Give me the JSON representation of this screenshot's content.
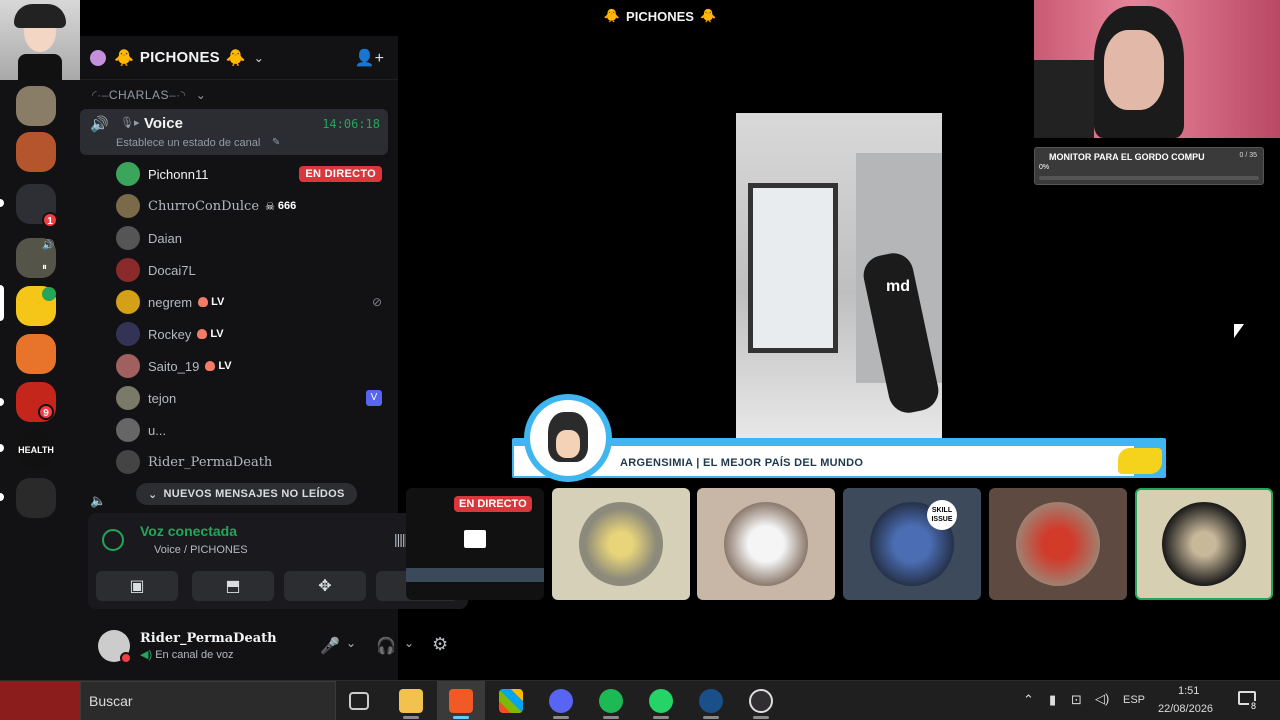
{
  "stage": {
    "title": "PICHONES",
    "banner_text": "ARGENSIMIA | EL MEJOR PAÍS DEL MUNDO",
    "video_watermark": "md"
  },
  "server": {
    "name": "PICHONES",
    "category": "CHARLAS",
    "rail_badges": [
      "1",
      "9"
    ],
    "rail_health_label": "HEALTH",
    "voice_channel": {
      "name": "Voice",
      "timer": "14:06:18",
      "status_placeholder": "Establece un estado de canal"
    },
    "members": [
      {
        "name": "Pichonn11",
        "live": "EN DIRECTO",
        "color": "#3ba55c"
      },
      {
        "name": "ChurroConDulce",
        "tag": "666",
        "color": "#7a6a4a"
      },
      {
        "name": "Daian",
        "color": "#555"
      },
      {
        "name": "Docai7L",
        "color": "#8b2a2a"
      },
      {
        "name": "negrem",
        "tag": "LV",
        "color": "#d4a017"
      },
      {
        "name": "Rockey",
        "tag": "LV",
        "color": "#335"
      },
      {
        "name": "Saito_19",
        "tag": "LV",
        "color": "#a06060"
      },
      {
        "name": "tejon",
        "color": "#7a7a6a"
      },
      {
        "name": "u...",
        "color": "#666"
      },
      {
        "name": "Rider_PermaDeath",
        "color": "#444"
      }
    ],
    "unread_label": "NUEVOS MENSAJES NO LEÍDOS"
  },
  "voice_panel": {
    "status": "Voz conectada",
    "location": "Voice / PICHONES"
  },
  "user_panel": {
    "username": "Rider_PermaDeath",
    "status": "En canal de voz"
  },
  "thumbs": {
    "live_label": "EN DIRECTO",
    "skill_label": "SKILL ISSUE"
  },
  "monitor_widget": {
    "title": "MONITOR PARA EL GORDO COMPU",
    "progress_text": "0 / 35",
    "percent_label": "0%"
  },
  "taskbar": {
    "search_placeholder": "Buscar",
    "language": "ESP",
    "time": "1:51",
    "date": "22/08/2026",
    "notifications": "8"
  },
  "colors": {
    "accent_green": "#23a55a",
    "live_red": "#da373c",
    "banner_blue": "#3fb6ef"
  }
}
